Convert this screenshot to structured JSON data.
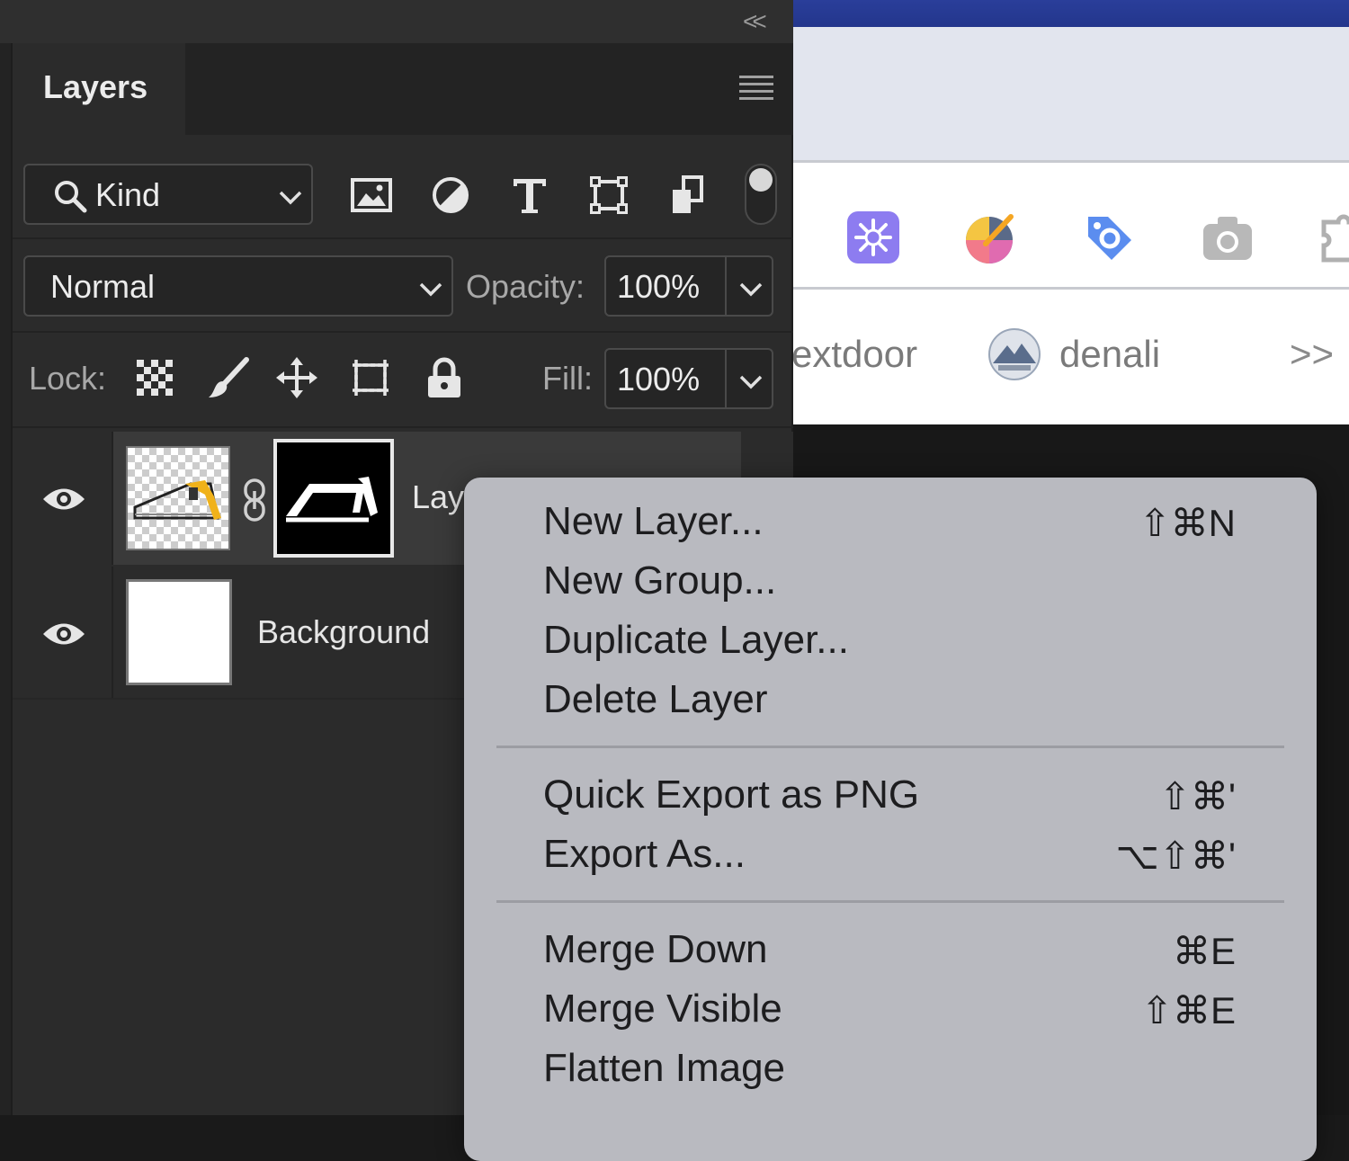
{
  "panel": {
    "collapse_label": "<<",
    "tab_title": "Layers",
    "filter": {
      "icon": "search-icon",
      "kind_label": "Kind"
    },
    "filter_icons": [
      "image-filter-icon",
      "adjustment-filter-icon",
      "type-filter-icon",
      "shape-filter-icon",
      "smart-object-filter-icon"
    ],
    "blend_mode": "Normal",
    "opacity_label": "Opacity:",
    "opacity_value": "100%",
    "lock_label": "Lock:",
    "lock_icons": [
      "lock-transparent-pixels-icon",
      "lock-image-pixels-icon",
      "lock-position-icon",
      "lock-artboard-icon",
      "lock-all-icon"
    ],
    "fill_label": "Fill:",
    "fill_value": "100%",
    "layers": [
      {
        "name": "Lay",
        "visible": true,
        "selected": true,
        "has_mask": true
      },
      {
        "name": "Background",
        "visible": true,
        "selected": false,
        "has_mask": false
      }
    ]
  },
  "browser": {
    "extensions": [
      "perplexity-extension-icon",
      "color-picker-extension-icon",
      "price-tag-extension-icon",
      "camera-extension-icon",
      "puzzle-extension-icon"
    ],
    "bookmarks": [
      {
        "label": "extdoor"
      },
      {
        "label": "denali",
        "icon": "denali-bookmark-icon"
      }
    ],
    "overflow_label": ">>"
  },
  "context_menu": {
    "groups": [
      [
        {
          "label": "New Layer...",
          "shortcut": "⇧⌘N"
        },
        {
          "label": "New Group...",
          "shortcut": ""
        },
        {
          "label": "Duplicate Layer...",
          "shortcut": ""
        },
        {
          "label": "Delete Layer",
          "shortcut": ""
        }
      ],
      [
        {
          "label": "Quick Export as PNG",
          "shortcut": "⇧⌘'"
        },
        {
          "label": "Export As...",
          "shortcut": "⌥⇧⌘'"
        }
      ],
      [
        {
          "label": "Merge Down",
          "shortcut": "⌘E"
        },
        {
          "label": "Merge Visible",
          "shortcut": "⇧⌘E"
        },
        {
          "label": "Flatten Image",
          "shortcut": ""
        }
      ]
    ]
  },
  "colors": {
    "panel_bg": "#2b2b2b",
    "menu_bg": "#b9bac0",
    "browser_top": "#2a3e9a",
    "layer_selected": "#3a3a3a"
  }
}
